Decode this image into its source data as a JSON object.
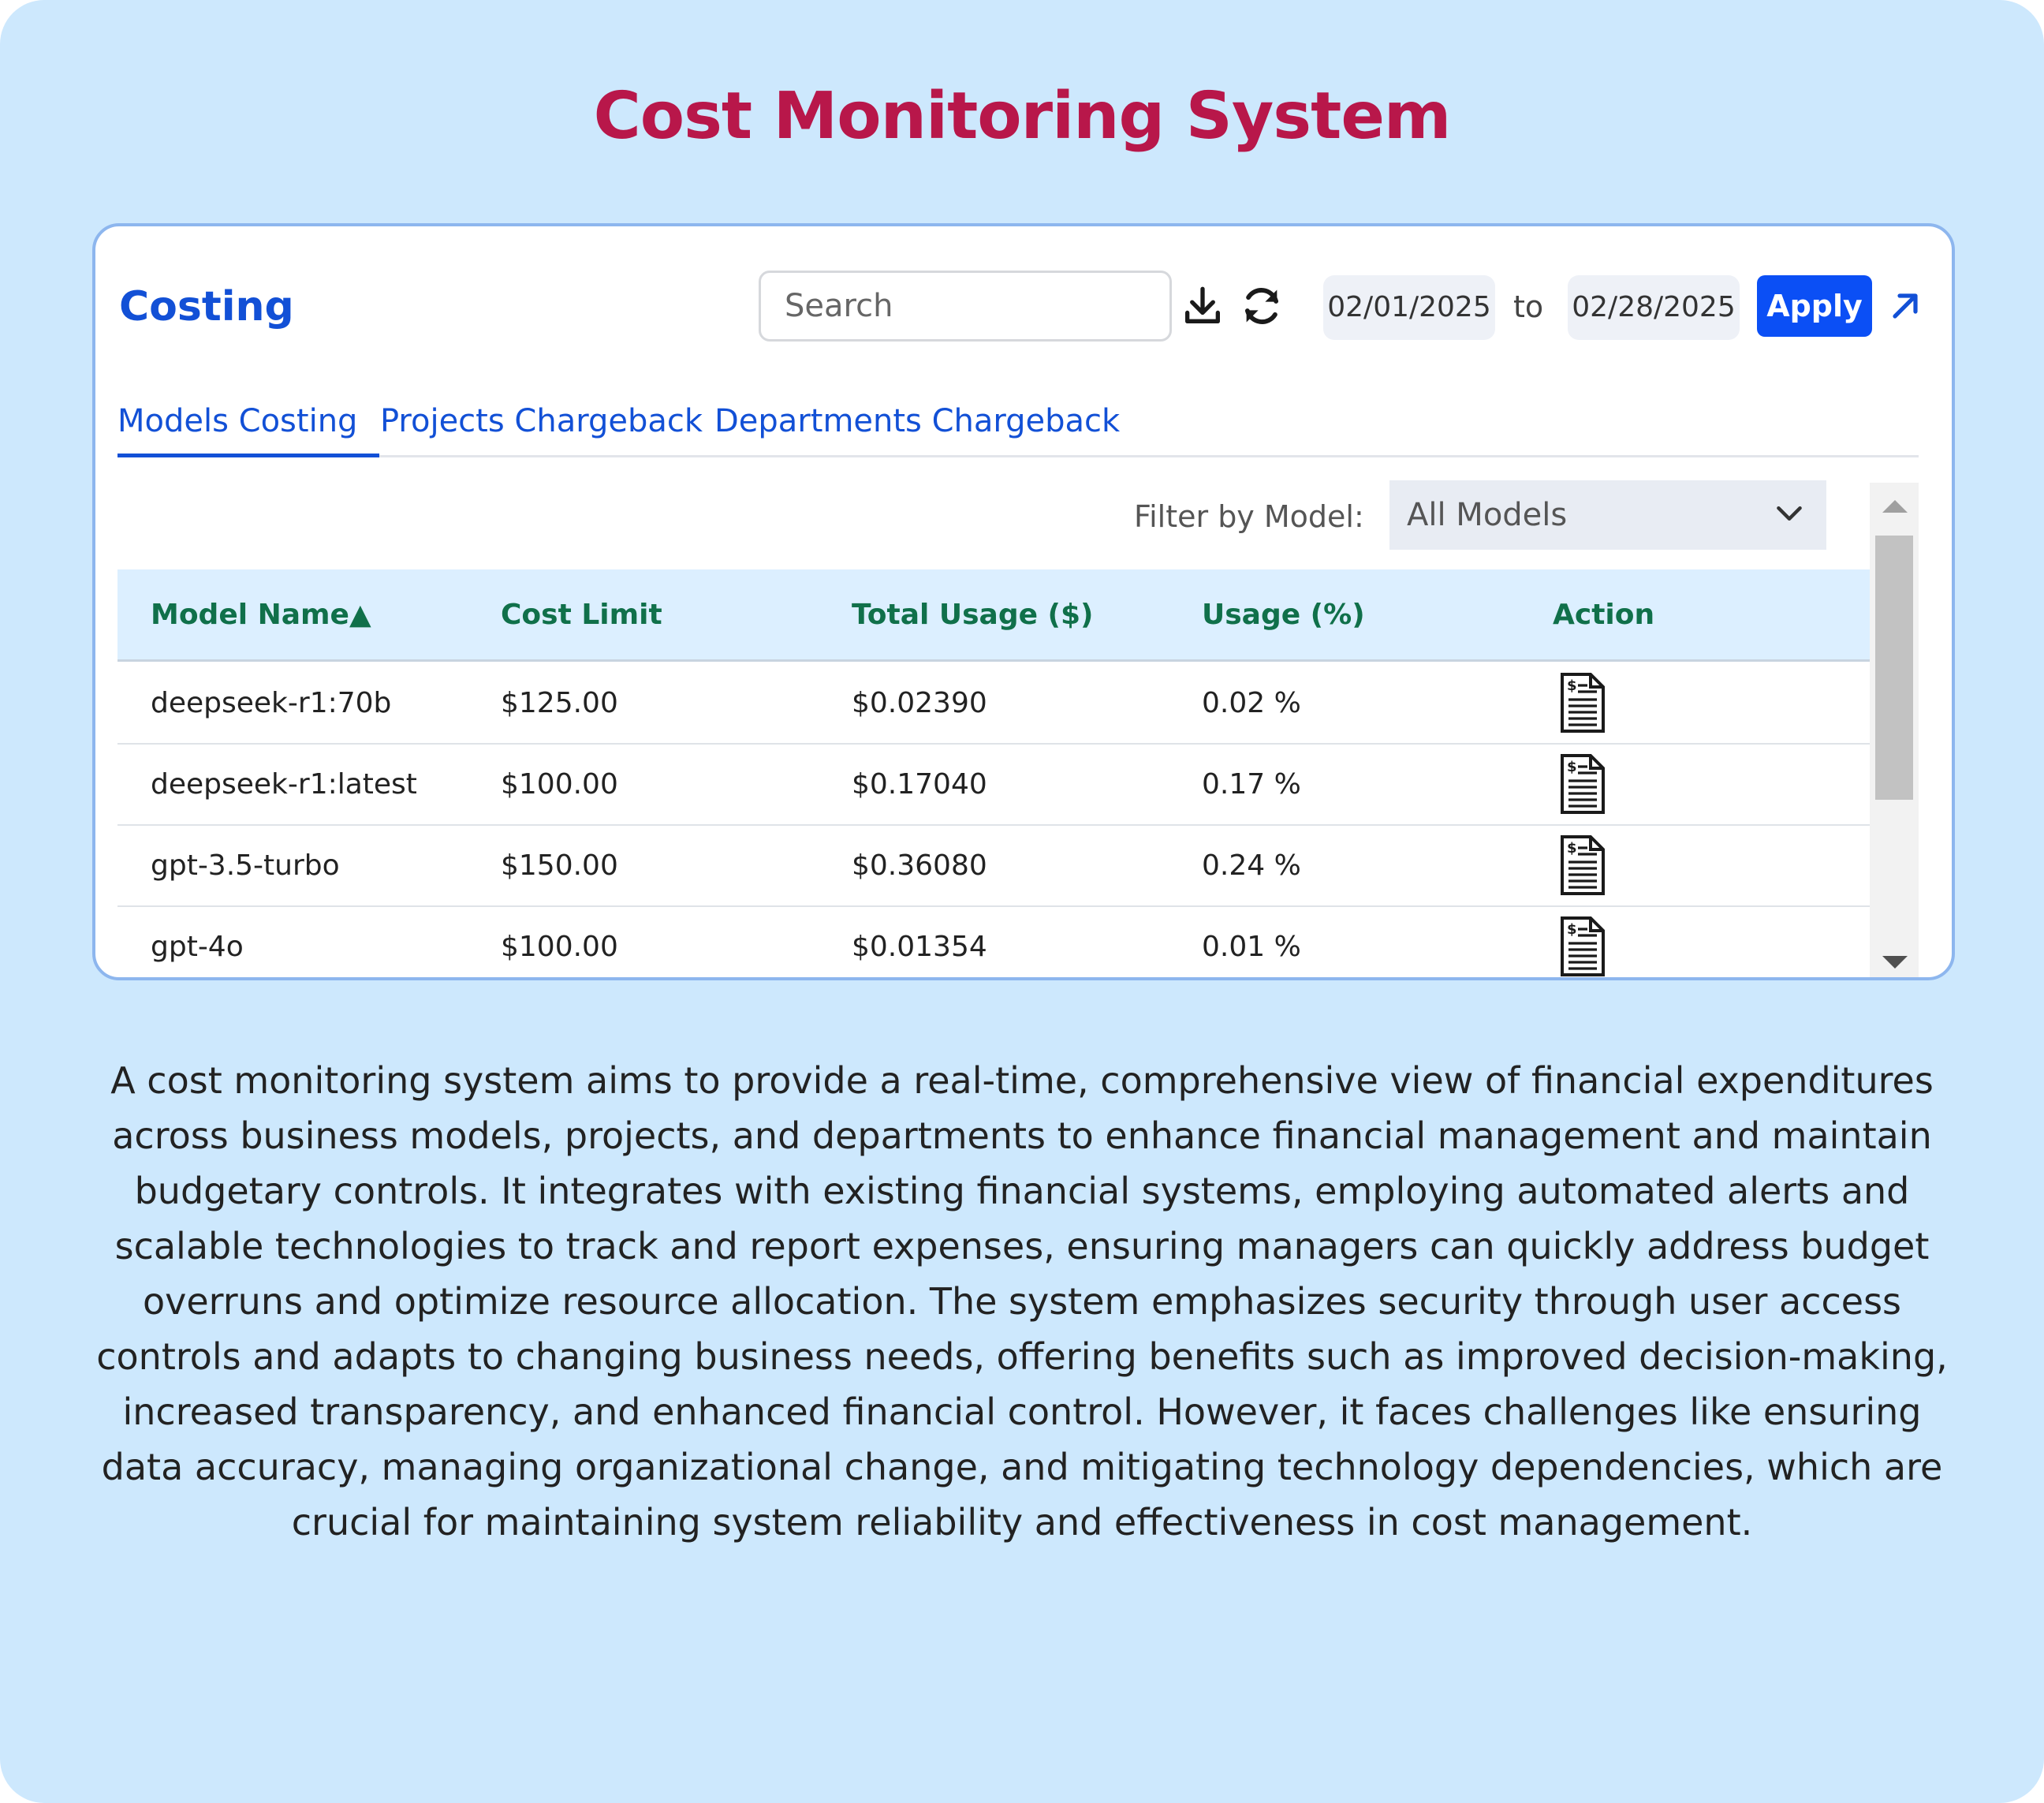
{
  "page": {
    "title": "Cost Monitoring System",
    "description": "A cost monitoring system aims to provide a real-time, comprehensive view of financial expenditures across business models, projects, and departments to enhance financial management and maintain budgetary controls. It integrates with existing financial systems, employing automated alerts and scalable technologies to track and report expenses, ensuring managers can quickly address budget overruns and optimize resource allocation. The system emphasizes security through user access controls and adapts to changing business needs, offering benefits such as improved decision-making, increased transparency, and enhanced financial control. However, it faces challenges like ensuring data accuracy, managing organizational change, and mitigating technology dependencies, which are crucial for maintaining system reliability and effectiveness in cost management."
  },
  "card": {
    "title": "Costing",
    "search": {
      "placeholder": "Search",
      "value": ""
    },
    "date_from": "02/01/2025",
    "to_label": "to",
    "date_to": "02/28/2025",
    "apply_label": "Apply",
    "icons": {
      "download": "download-icon",
      "refresh": "refresh-icon",
      "expand": "external-arrow-icon"
    }
  },
  "tabs": [
    {
      "label": "Models Costing",
      "active": true
    },
    {
      "label": "Projects Chargeback",
      "active": false
    },
    {
      "label": "Departments Chargeback",
      "active": false
    }
  ],
  "filter": {
    "label": "Filter by Model:",
    "selected": "All Models"
  },
  "table": {
    "headers": [
      "Model Name",
      "Cost Limit",
      "Total Usage ($)",
      "Usage (%)",
      "Action"
    ],
    "sort_indicator": "▲",
    "rows": [
      {
        "model": "deepseek-r1:70b",
        "limit": "$125.00",
        "usage": "$0.02390",
        "percent": "0.02 %"
      },
      {
        "model": "deepseek-r1:latest",
        "limit": "$100.00",
        "usage": "$0.17040",
        "percent": "0.17 %"
      },
      {
        "model": "gpt-3.5-turbo",
        "limit": "$150.00",
        "usage": "$0.36080",
        "percent": "0.24 %"
      },
      {
        "model": "gpt-4o",
        "limit": "$100.00",
        "usage": "$0.01354",
        "percent": "0.01 %"
      }
    ],
    "action_icon": "invoice-document-icon"
  },
  "colors": {
    "page_bg": "#cde8fd",
    "title": "#b8174a",
    "accent": "#1250d6",
    "apply": "#0b4ff5",
    "header_text": "#10704a",
    "header_bg": "#dcefff"
  }
}
